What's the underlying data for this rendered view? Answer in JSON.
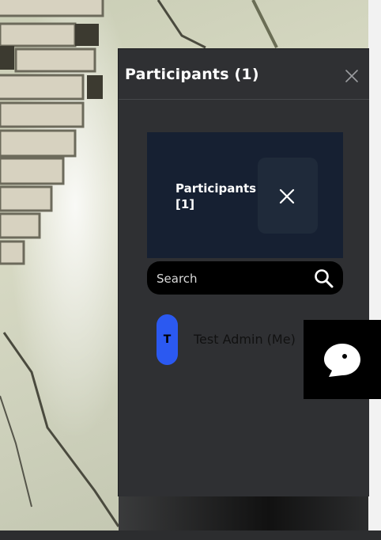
{
  "panel": {
    "title": "Participants (1)",
    "close_icon": "close-icon"
  },
  "card": {
    "title": "Participants [1]",
    "close_icon": "close-icon"
  },
  "search": {
    "placeholder": "Search",
    "icon": "search-icon"
  },
  "participants": [
    {
      "initial": "T",
      "name": "Test Admin (Me)"
    }
  ],
  "chat": {
    "icon": "chat-bubble-icon"
  },
  "colors": {
    "panel_bg": "#2f3033",
    "card_bg": "#162032",
    "avatar_bg": "#2b59f1",
    "search_bg": "#000000"
  }
}
